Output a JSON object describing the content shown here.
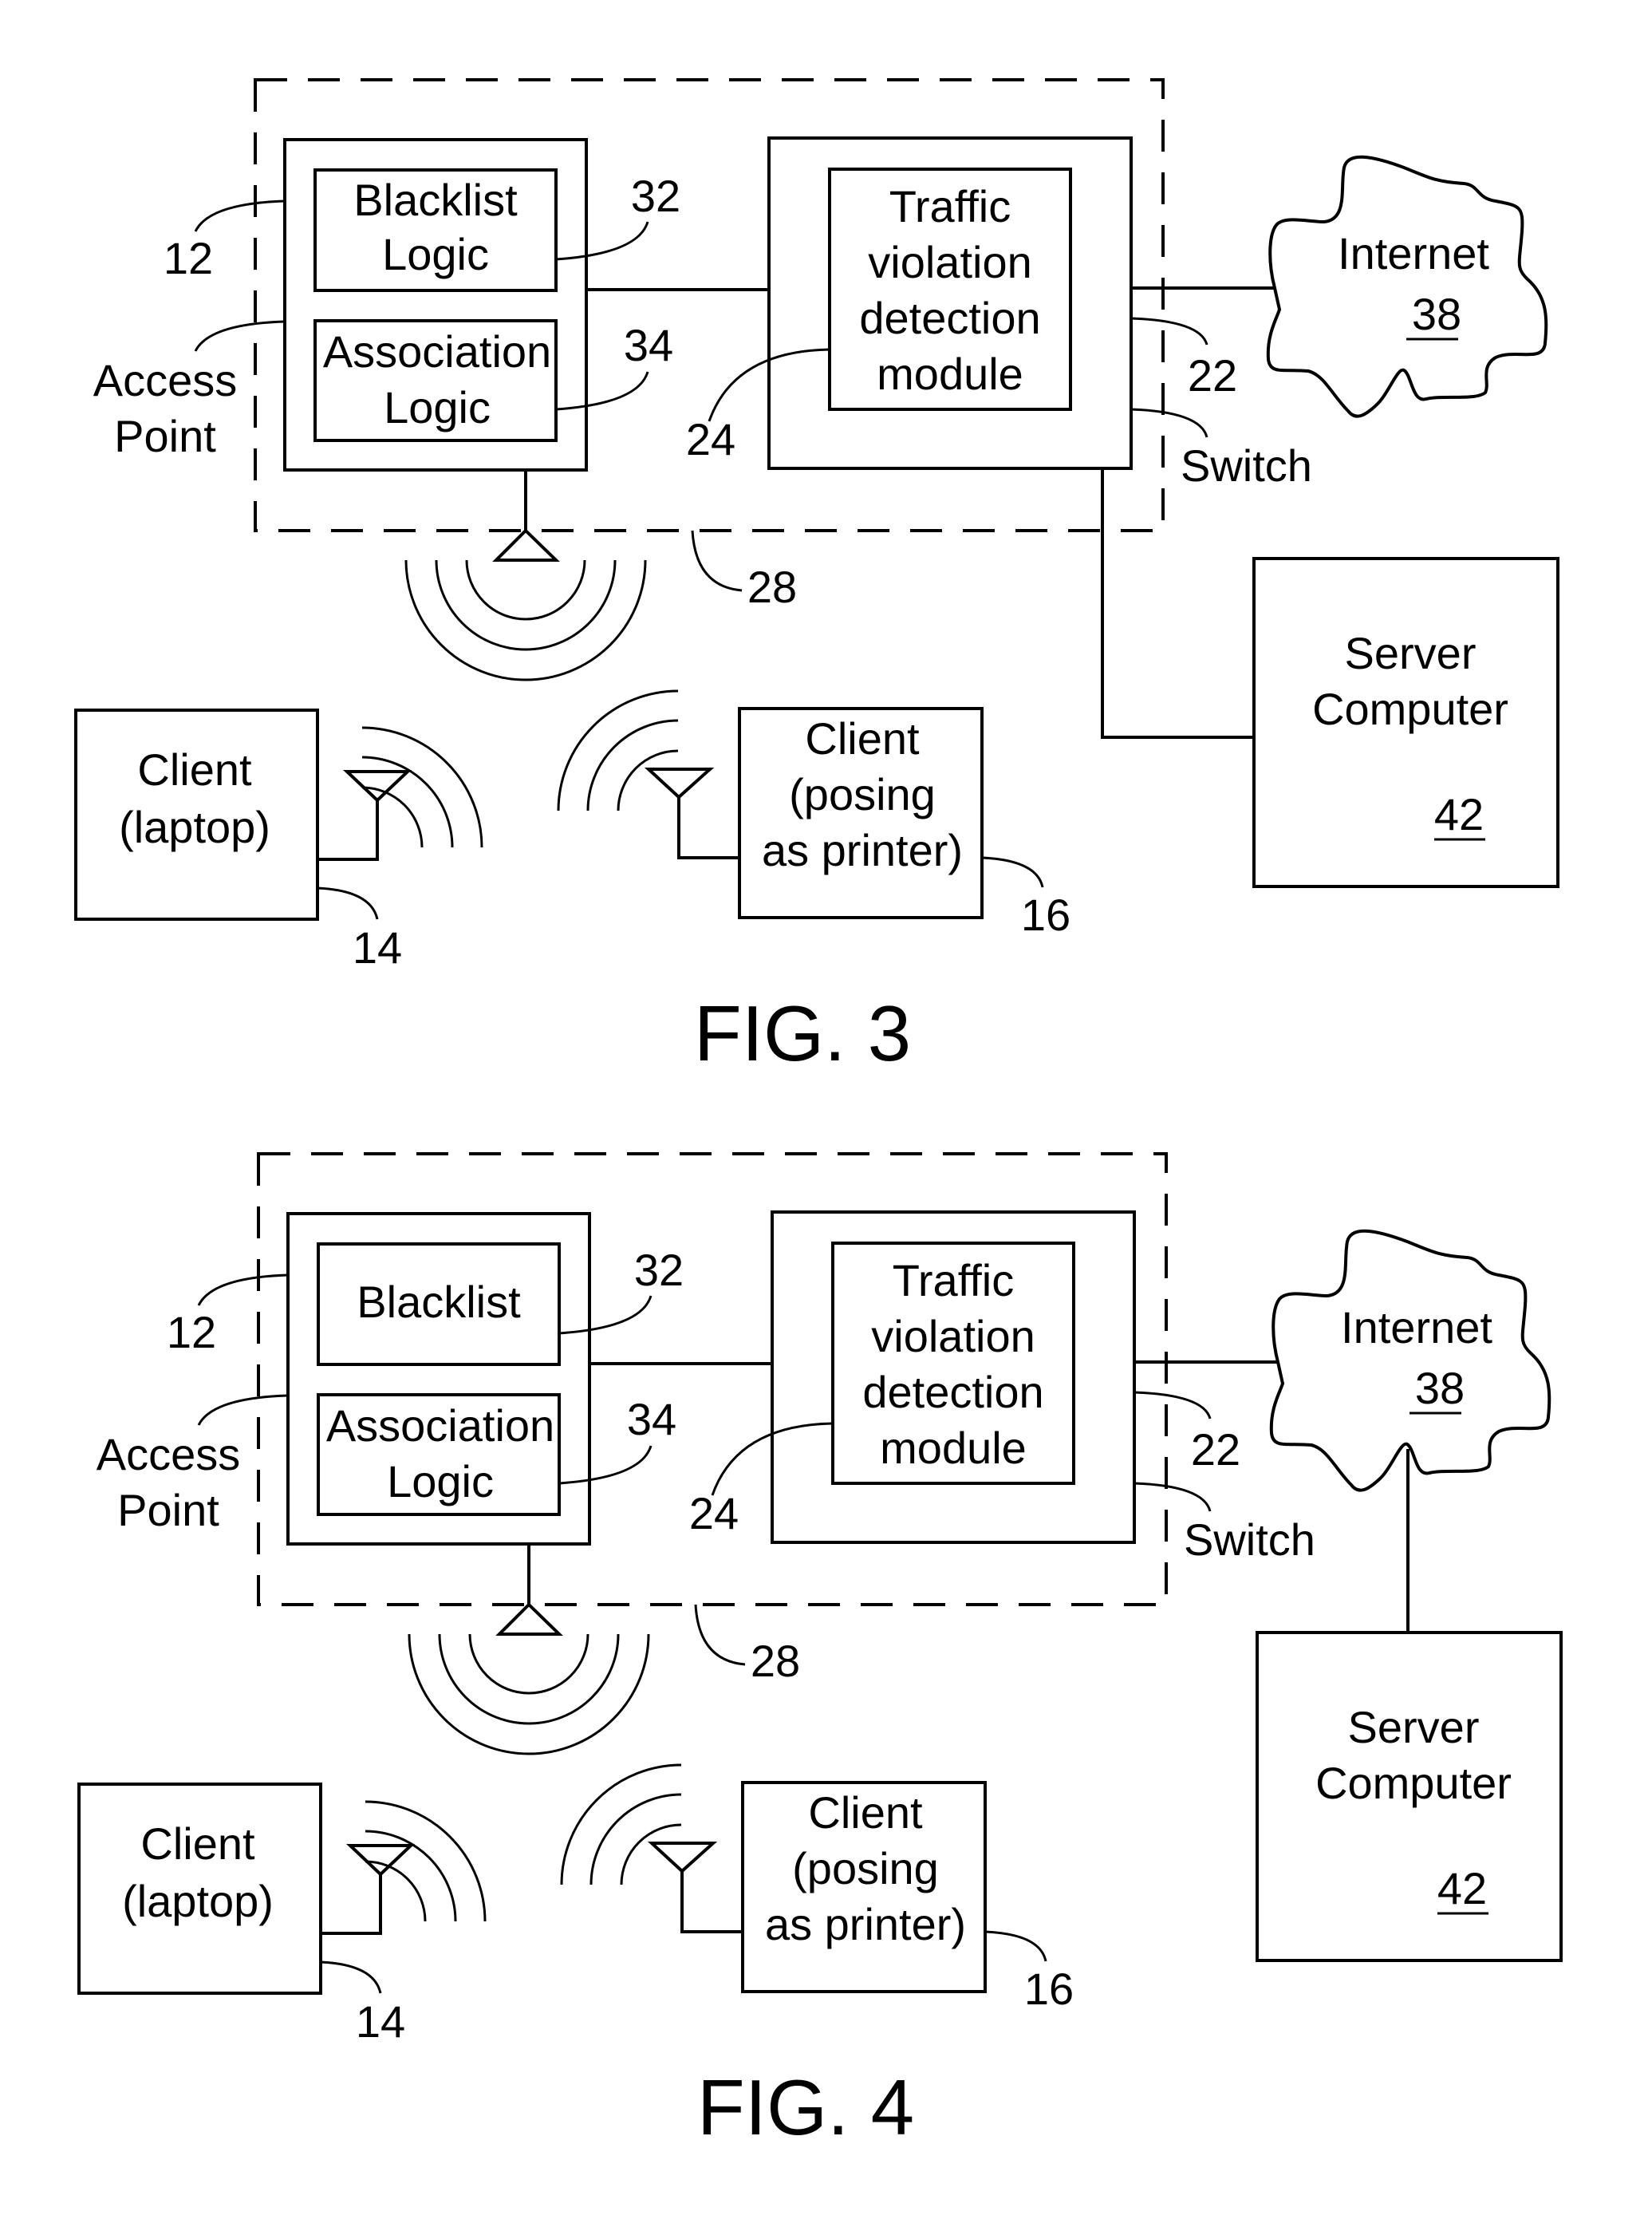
{
  "colors": {
    "ink": "#000000",
    "paper": "#ffffff"
  },
  "figures": [
    {
      "id": "fig3",
      "caption": "FIG. 3",
      "access_point": {
        "ref": "12",
        "label_lines": [
          "Access",
          "Point"
        ],
        "blacklist_lines": [
          "Blacklist",
          "Logic"
        ],
        "blacklist_ref": "32",
        "association_lines": [
          "Association",
          "Logic"
        ],
        "association_ref": "34"
      },
      "enclosure_ref": "28",
      "switch": {
        "ref": "22",
        "label": "Switch",
        "module_lines": [
          "Traffic",
          "violation",
          "detection",
          "module"
        ],
        "module_ref": "24"
      },
      "internet": {
        "label": "Internet",
        "ref": "38"
      },
      "server": {
        "label_lines": [
          "Server",
          "Computer"
        ],
        "ref": "42",
        "connected_to": "switch"
      },
      "client_laptop": {
        "label_lines": [
          "Client",
          "(laptop)"
        ],
        "ref": "14"
      },
      "client_printer": {
        "label_lines": [
          "Client",
          "(posing",
          "as printer)"
        ],
        "ref": "16"
      }
    },
    {
      "id": "fig4",
      "caption": "FIG. 4",
      "access_point": {
        "ref": "12",
        "label_lines": [
          "Access",
          "Point"
        ],
        "blacklist_lines": [
          "Blacklist"
        ],
        "blacklist_ref": "32",
        "association_lines": [
          "Association",
          "Logic"
        ],
        "association_ref": "34"
      },
      "enclosure_ref": "28",
      "switch": {
        "ref": "22",
        "label": "Switch",
        "module_lines": [
          "Traffic",
          "violation",
          "detection",
          "module"
        ],
        "module_ref": "24"
      },
      "internet": {
        "label": "Internet",
        "ref": "38"
      },
      "server": {
        "label_lines": [
          "Server",
          "Computer"
        ],
        "ref": "42",
        "connected_to": "internet"
      },
      "client_laptop": {
        "label_lines": [
          "Client",
          "(laptop)"
        ],
        "ref": "14"
      },
      "client_printer": {
        "label_lines": [
          "Client",
          "(posing",
          "as printer)"
        ],
        "ref": "16"
      }
    }
  ]
}
